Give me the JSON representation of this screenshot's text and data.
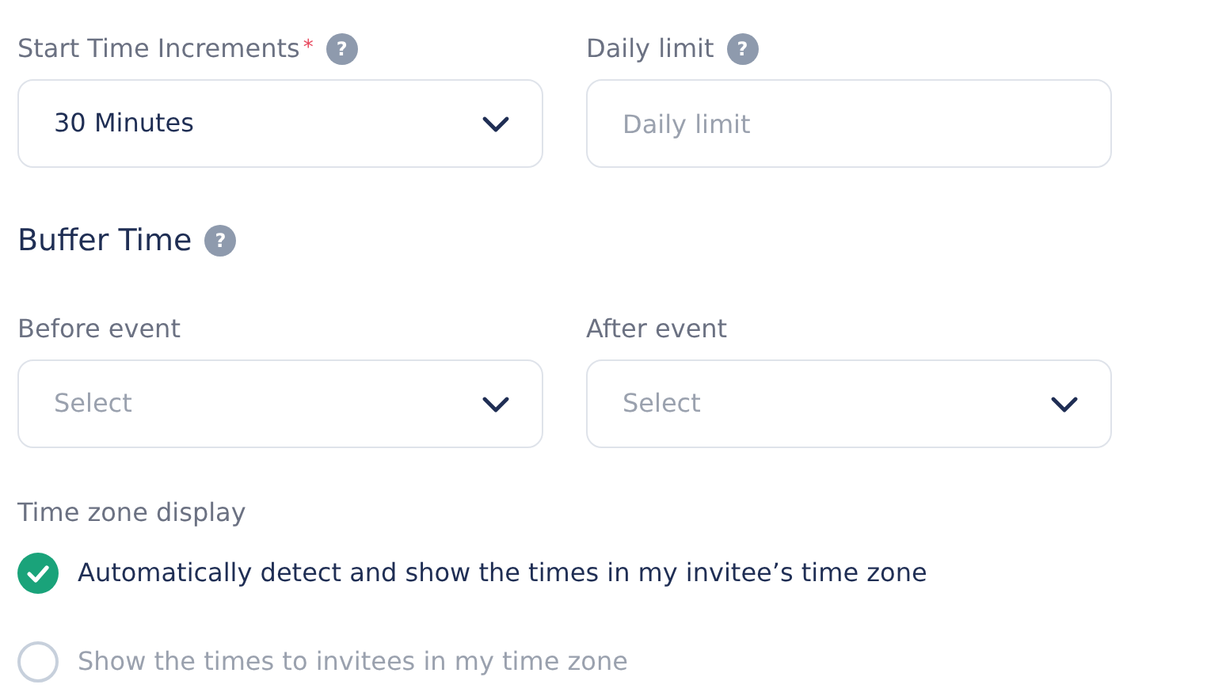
{
  "top_fields": [
    {
      "label": "Start Time Increments",
      "required": true,
      "help": "?",
      "kind": "select",
      "value": "30 Minutes"
    },
    {
      "label": "Daily limit",
      "required": false,
      "help": "?",
      "kind": "input",
      "placeholder": "Daily limit"
    }
  ],
  "buffer": {
    "title": "Buffer Time",
    "help": "?",
    "fields": [
      {
        "label": "Before event",
        "kind": "select",
        "placeholder": "Select"
      },
      {
        "label": "After event",
        "kind": "select",
        "placeholder": "Select"
      }
    ]
  },
  "timezone": {
    "label": "Time zone display",
    "options": [
      {
        "label": "Automatically detect and show the times in my invitee’s time zone",
        "selected": true
      },
      {
        "label": "Show the times to invitees in my time zone",
        "selected": false
      }
    ]
  },
  "required_mark": "*"
}
